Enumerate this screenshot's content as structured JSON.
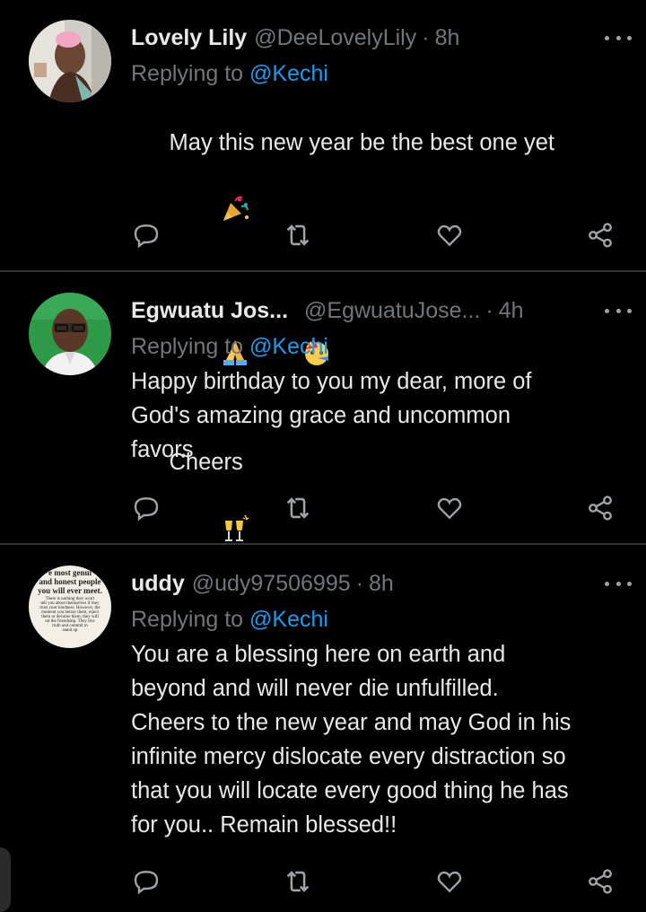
{
  "tweets": [
    {
      "name": "Lovely Lily",
      "handle": "@DeeLovelyLily",
      "dot": "·",
      "time": "8h",
      "replying_prefix": "Replying to ",
      "replying_to": "@Kechi",
      "text_line1": "May this new year be the best one yet",
      "text_line3": "Cheers"
    },
    {
      "name": "Egwuatu Jos...",
      "handle": "@EgwuatuJose...",
      "dot": "·",
      "time": "4h",
      "replying_prefix": "Replying to ",
      "replying_to": "@Kechi",
      "text": "Happy birthday to you my dear, more of\nGod's amazing grace and uncommon\nfavors"
    },
    {
      "name": "uddy",
      "handle": "@udy97506995",
      "dot": "·",
      "time": "8h",
      "replying_prefix": "Replying to ",
      "replying_to": "@Kechi",
      "text": "You are a blessing here on earth and\nbeyond and will never die unfulfilled.\nCheers to the new year and may God in his\ninfinite mercy dislocate every distraction so\nthat you will locate every good thing he has\nfor you.. Remain blessed!!",
      "avatar_lines": [
        "e most genui",
        "and honest people",
        "you will ever meet.",
        "There is nothing they won't",
        "tell you about themselves if they",
        "trust your kindness. However, the",
        "moment you betray them, reject",
        "them or devalue them, they will",
        "nd the friendship. They live",
        "truth and commit to",
        "stand up"
      ]
    }
  ],
  "icons": {
    "reply": "reply-icon",
    "retweet": "retweet-icon",
    "like": "like-icon",
    "share": "share-icon",
    "more": "more-icon"
  },
  "colors": {
    "background": "#000000",
    "text": "#e7e9ea",
    "muted": "#71767b",
    "accent": "#1d9bf0",
    "divider": "#2f3336"
  }
}
